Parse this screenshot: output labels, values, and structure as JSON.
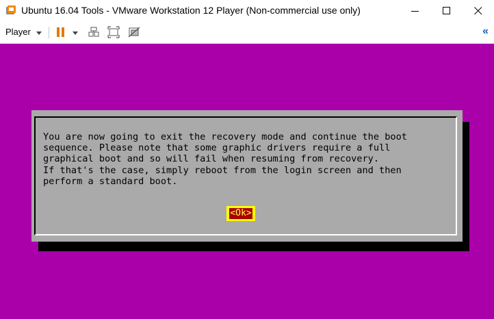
{
  "window": {
    "title": "Ubuntu 16.04 Tools - VMware Workstation 12 Player (Non-commercial use only)",
    "icon": "vmware-player-icon",
    "minimize_icon": "minimize-icon",
    "maximize_icon": "maximize-icon",
    "close_icon": "close-icon"
  },
  "toolbar": {
    "player_label": "Player",
    "buttons": [
      "pause-icon",
      "send-ctrl-alt-del-icon",
      "full-screen-icon",
      "unity-icon"
    ],
    "collapse_glyph": "«",
    "accent_color": "#e07b00"
  },
  "guest": {
    "background_color": "#aa00aa",
    "dialog": {
      "message_lines": [
        "You are now going to exit the recovery mode and continue the boot",
        "sequence. Please note that some graphic drivers require a full",
        "graphical boot and so will fail when resuming from recovery.",
        "If that's the case, simply reboot from the login screen and then",
        "perform a standard boot."
      ],
      "ok_label": "<Ok>"
    }
  }
}
